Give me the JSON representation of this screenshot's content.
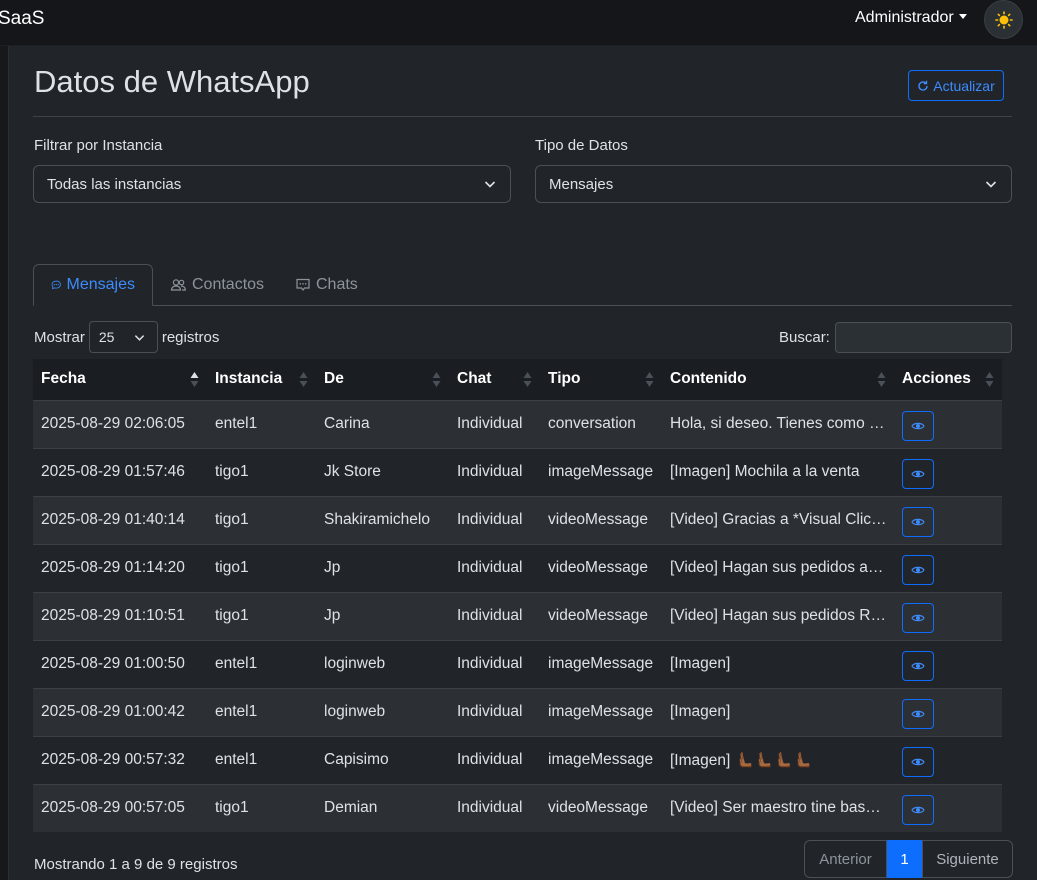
{
  "navbar": {
    "brand": "SaaS",
    "user_menu": "Administrador",
    "theme_icon": "sun-icon"
  },
  "header": {
    "title": "Datos de WhatsApp",
    "refresh_label": "Actualizar"
  },
  "filters": {
    "instance_label": "Filtrar por Instancia",
    "instance_value": "Todas las instancias",
    "type_label": "Tipo de Datos",
    "type_value": "Mensajes"
  },
  "tabs": [
    {
      "label": "Mensajes",
      "icon": "chat-dots-icon",
      "active": true
    },
    {
      "label": "Contactos",
      "icon": "people-icon",
      "active": false
    },
    {
      "label": "Chats",
      "icon": "chat-square-icon",
      "active": false
    }
  ],
  "table_controls": {
    "show_label": "Mostrar",
    "page_length": "25",
    "records_label": "registros",
    "search_label": "Buscar:"
  },
  "table": {
    "columns": [
      "Fecha",
      "Instancia",
      "De",
      "Chat",
      "Tipo",
      "Contenido",
      "Acciones"
    ],
    "rows": [
      {
        "fecha": "2025-08-29 02:06:05",
        "instancia": "entel1",
        "de": "Carina",
        "chat": "Individual",
        "tipo": "conversation",
        "contenido": "Hola, si deseo. Tienes como …"
      },
      {
        "fecha": "2025-08-29 01:57:46",
        "instancia": "tigo1",
        "de": "Jk Store",
        "chat": "Individual",
        "tipo": "imageMessage",
        "contenido": "[Imagen] Mochila a la venta"
      },
      {
        "fecha": "2025-08-29 01:40:14",
        "instancia": "tigo1",
        "de": "Shakiramichelo",
        "chat": "Individual",
        "tipo": "videoMessage",
        "contenido": "[Video] Gracias a *Visual Clic…"
      },
      {
        "fecha": "2025-08-29 01:14:20",
        "instancia": "tigo1",
        "de": "Jp",
        "chat": "Individual",
        "tipo": "videoMessage",
        "contenido": "[Video] Hagan sus pedidos a…"
      },
      {
        "fecha": "2025-08-29 01:10:51",
        "instancia": "tigo1",
        "de": "Jp",
        "chat": "Individual",
        "tipo": "videoMessage",
        "contenido": "[Video] Hagan sus pedidos R…"
      },
      {
        "fecha": "2025-08-29 01:00:50",
        "instancia": "entel1",
        "de": "loginweb",
        "chat": "Individual",
        "tipo": "imageMessage",
        "contenido": "[Imagen]"
      },
      {
        "fecha": "2025-08-29 01:00:42",
        "instancia": "entel1",
        "de": "loginweb",
        "chat": "Individual",
        "tipo": "imageMessage",
        "contenido": "[Imagen]"
      },
      {
        "fecha": "2025-08-29 00:57:32",
        "instancia": "entel1",
        "de": "Capisimo",
        "chat": "Individual",
        "tipo": "imageMessage",
        "contenido": "[Imagen] 🫷🏾🫷🏾🫷🏾🫷🏾"
      },
      {
        "fecha": "2025-08-29 00:57:05",
        "instancia": "tigo1",
        "de": "Demian",
        "chat": "Individual",
        "tipo": "videoMessage",
        "contenido": "[Video] Ser maestro tine bas…"
      }
    ]
  },
  "footer": {
    "info": "Mostrando 1 a 9 de 9 registros",
    "prev_label": "Anterior",
    "current_page": "1",
    "next_label": "Siguiente"
  },
  "colors": {
    "accent": "#0d6efd",
    "background": "#212529"
  }
}
